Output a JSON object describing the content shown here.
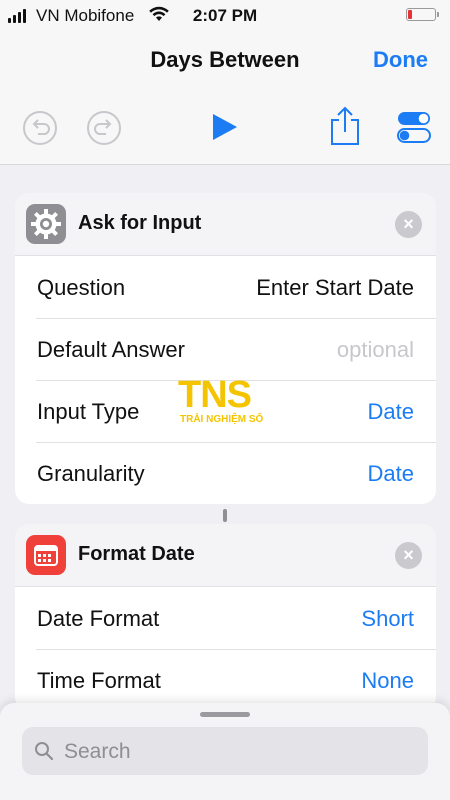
{
  "status_bar": {
    "carrier": "VN Mobifone",
    "time": "2:07 PM",
    "battery_level": 0.15,
    "battery_color": "#e33333"
  },
  "nav": {
    "title": "Days Between",
    "done_label": "Done"
  },
  "toolbar": {
    "icons": [
      "undo-icon",
      "redo-icon",
      "play-icon",
      "share-icon",
      "settings-toggle-icon"
    ]
  },
  "cards": [
    {
      "title": "Ask for Input",
      "icon": "gear-icon",
      "rows": [
        {
          "label": "Question",
          "value": "Enter Start Date",
          "style": "normal"
        },
        {
          "label": "Default Answer",
          "value": "optional",
          "style": "muted"
        },
        {
          "label": "Input Type",
          "value": "Date",
          "style": "link"
        },
        {
          "label": "Granularity",
          "value": "Date",
          "style": "link"
        }
      ]
    },
    {
      "title": "Format Date",
      "icon": "calendar-icon",
      "rows": [
        {
          "label": "Date Format",
          "value": "Short",
          "style": "link"
        },
        {
          "label": "Time Format",
          "value": "None",
          "style": "link"
        }
      ]
    }
  ],
  "watermark": {
    "letters": "TNS",
    "subtitle": "TRẢI NGHIỆM SỐ"
  },
  "search": {
    "placeholder": "Search",
    "value": ""
  },
  "colors": {
    "accent": "#1c7cf4",
    "background": "#efeff4",
    "calendar_red": "#f0403a",
    "gear_gray": "#8e8e93"
  }
}
